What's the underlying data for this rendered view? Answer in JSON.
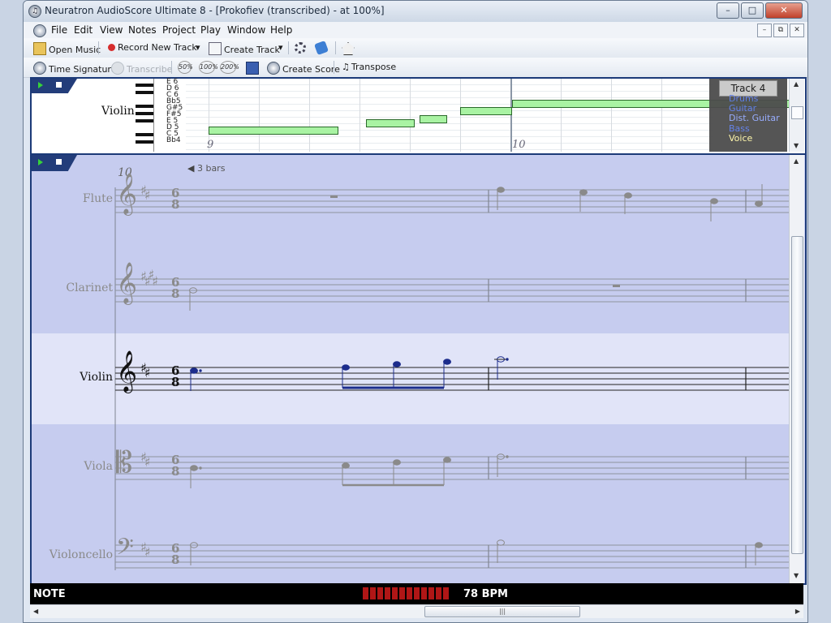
{
  "window": {
    "title": "Neuratron AudioScore Ultimate 8 - [Prokofiev (transcribed) - at 100%]",
    "minimize": "–",
    "maximize": "□",
    "close": "✕"
  },
  "menu": [
    "File",
    "Edit",
    "View",
    "Notes",
    "Project",
    "Play",
    "Window",
    "Help"
  ],
  "toolbar1": {
    "open_music": "Open Music",
    "record_new_track": "Record New Track",
    "create_track": "Create Track"
  },
  "toolbar2": {
    "time_signature": "Time Signature",
    "transcribe": "Transcribe",
    "zoom_50": "50%",
    "zoom_100": "100%",
    "zoom_200": "200%",
    "create_score": "Create Score",
    "transpose": "Transpose"
  },
  "piano_roll": {
    "instrument": "Violin",
    "note_names": [
      "E 6",
      "D 6",
      "C 6",
      "Bb5",
      "G#5",
      "F#5",
      "E 5",
      "D 5",
      "C 5",
      "Bb4"
    ],
    "bar_start": "9",
    "bar_next": "10",
    "track_label": "Track 4",
    "track_items": [
      "Drums",
      "Guitar",
      "Dist. Guitar",
      "Bass",
      "Voice"
    ],
    "selected_track": "Voice"
  },
  "score": {
    "bar_number": "10",
    "bars_nav": "3 bars",
    "staves": [
      {
        "name": "Flute",
        "clef": "treble",
        "key": "##",
        "time_top": "6",
        "time_bottom": "8",
        "active": false
      },
      {
        "name": "Clarinet",
        "clef": "treble",
        "key": "####",
        "time_top": "6",
        "time_bottom": "8",
        "active": false
      },
      {
        "name": "Violin",
        "clef": "treble",
        "key": "##",
        "time_top": "6",
        "time_bottom": "8",
        "active": true
      },
      {
        "name": "Viola",
        "clef": "alto",
        "key": "##",
        "time_top": "6",
        "time_bottom": "8",
        "active": false
      },
      {
        "name": "Violoncello",
        "clef": "bass",
        "key": "##",
        "time_top": "6",
        "time_bottom": "8",
        "active": false
      }
    ],
    "glyphs": {
      "treble": "𝄞",
      "alto": "𝄡",
      "bass": "𝄢",
      "sharp": "♯"
    }
  },
  "status": {
    "mode": "NOTE",
    "tempo": "78 BPM"
  },
  "colors": {
    "score_bg": "#c6ccef",
    "active_stave_bg": "#e1e4f8",
    "note_active": "#1c2c8c",
    "note_inactive": "#8a8a8a",
    "piano_roll_note": "#a9f3a3"
  }
}
